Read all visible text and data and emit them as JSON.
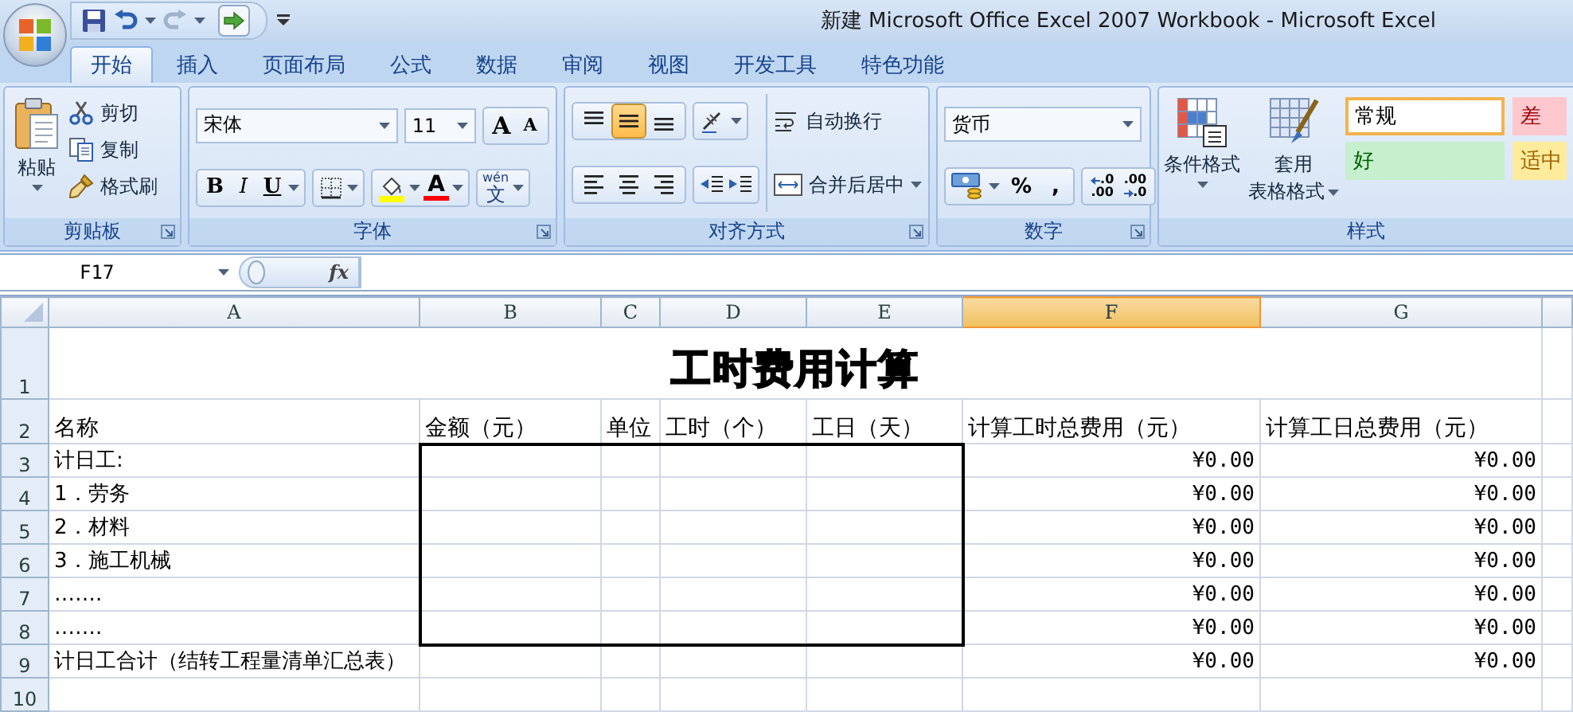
{
  "window": {
    "title": "新建 Microsoft Office Excel 2007 Workbook - Microsoft Excel"
  },
  "tabs": [
    {
      "label": "开始",
      "selected": true
    },
    {
      "label": "插入",
      "selected": false
    },
    {
      "label": "页面布局",
      "selected": false
    },
    {
      "label": "公式",
      "selected": false
    },
    {
      "label": "数据",
      "selected": false
    },
    {
      "label": "审阅",
      "selected": false
    },
    {
      "label": "视图",
      "selected": false
    },
    {
      "label": "开发工具",
      "selected": false
    },
    {
      "label": "特色功能",
      "selected": false
    }
  ],
  "clipboard": {
    "label": "剪贴板",
    "paste": "粘贴",
    "actions": [
      {
        "kind": "cut",
        "label": "剪切"
      },
      {
        "kind": "copy",
        "label": "复制"
      },
      {
        "kind": "painter",
        "label": "格式刷"
      }
    ]
  },
  "font": {
    "label": "字体",
    "name": "宋体",
    "size": "11",
    "grow": "A",
    "shrink": "A",
    "bold": "B",
    "italic": "I",
    "underline": "U",
    "font_color": "A",
    "phonetic": "wén",
    "phonetic_char": "文"
  },
  "alignment": {
    "label": "对齐方式",
    "vertical": [
      {
        "kind": "top",
        "selected": false
      },
      {
        "kind": "middle",
        "selected": true
      },
      {
        "kind": "bottom",
        "selected": false
      }
    ],
    "horizontal": [
      {
        "kind": "left",
        "selected": false
      },
      {
        "kind": "center",
        "selected": false
      },
      {
        "kind": "right",
        "selected": false
      }
    ],
    "wrap_text": "自动换行",
    "merge_center": "合并后居中"
  },
  "number": {
    "label": "数字",
    "format": "货币",
    "percent": "%",
    "comma": ",",
    "increase_decimal": [
      ".0",
      ".00"
    ],
    "decrease_decimal": [
      ".00",
      ".0"
    ]
  },
  "styles": {
    "label": "样式",
    "conditional_formatting": "条件格式",
    "format_as_table": [
      "套用",
      "表格格式"
    ],
    "cell_styles": [
      {
        "label": "常规",
        "kind": "normal",
        "selected": true
      },
      {
        "label": "差",
        "kind": "bad",
        "selected": false
      },
      {
        "label": "好",
        "kind": "good",
        "selected": false
      },
      {
        "label": "适中",
        "kind": "neutral",
        "selected": false
      }
    ]
  },
  "formula_bar": {
    "name_box": "F17",
    "function_label": "fx"
  },
  "sheet": {
    "columns": [
      {
        "label": "A",
        "selected": false
      },
      {
        "label": "B",
        "selected": false
      },
      {
        "label": "C",
        "selected": false
      },
      {
        "label": "D",
        "selected": false
      },
      {
        "label": "E",
        "selected": false
      },
      {
        "label": "F",
        "selected": true
      },
      {
        "label": "G",
        "selected": false
      }
    ],
    "rows": [
      {
        "header": "1",
        "title": "工时费用计算"
      },
      {
        "header": "2",
        "headings": [
          "名称",
          "金额（元）",
          "单位",
          "工时（个）",
          "工日（天）",
          "计算工时总费用（元）",
          "计算工日总费用（元）"
        ]
      },
      {
        "header": "3",
        "boxed": true,
        "name": "计日工:",
        "hours_total": "¥0.00",
        "days_total": "¥0.00"
      },
      {
        "header": "4",
        "boxed": true,
        "name": "1．劳务",
        "hours_total": "¥0.00",
        "days_total": "¥0.00"
      },
      {
        "header": "5",
        "boxed": true,
        "name": "2．材料",
        "hours_total": "¥0.00",
        "days_total": "¥0.00"
      },
      {
        "header": "6",
        "boxed": true,
        "name": "3．施工机械",
        "hours_total": "¥0.00",
        "days_total": "¥0.00"
      },
      {
        "header": "7",
        "boxed": true,
        "name": "…….",
        "hours_total": "¥0.00",
        "days_total": "¥0.00"
      },
      {
        "header": "8",
        "boxed": true,
        "name": "…….",
        "hours_total": "¥0.00",
        "days_total": "¥0.00"
      },
      {
        "header": "9",
        "boxed": false,
        "name": "计日工合计（结转工程量清单汇总表）",
        "hours_total": "¥0.00",
        "days_total": "¥0.00"
      },
      {
        "header": "10",
        "boxed": false
      }
    ]
  }
}
